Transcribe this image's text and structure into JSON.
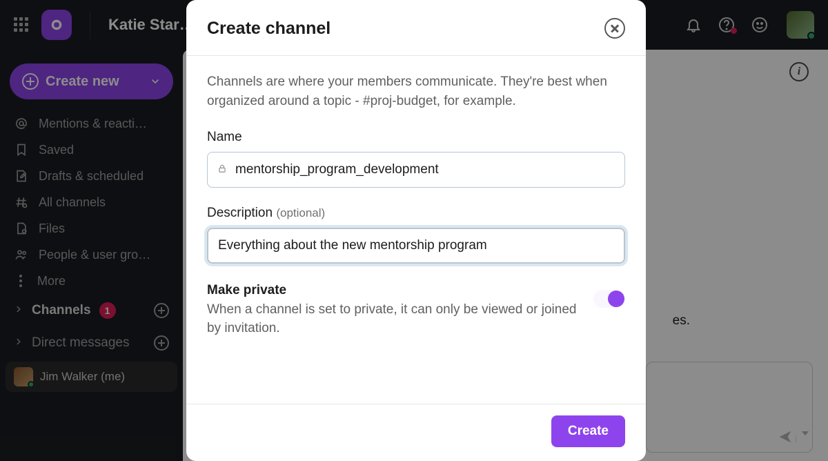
{
  "topbar": {
    "title": "Katie Star…"
  },
  "sidebar": {
    "create_label": "Create new",
    "items": [
      {
        "label": "Mentions & reacti…"
      },
      {
        "label": "Saved"
      },
      {
        "label": "Drafts & scheduled"
      },
      {
        "label": "All channels"
      },
      {
        "label": "Files"
      },
      {
        "label": "People & user gro…"
      },
      {
        "label": "More"
      }
    ],
    "channels_label": "Channels",
    "channels_badge": "1",
    "dms_label": "Direct messages",
    "dm_self": "Jim Walker (me)"
  },
  "main": {
    "fragment": "es."
  },
  "modal": {
    "title": "Create channel",
    "help": "Channels are where your members communicate. They're best when organized around a topic - #proj-budget, for example.",
    "name_label": "Name",
    "name_value": "mentorship_program_development",
    "desc_label": "Description",
    "desc_optional": "(optional)",
    "desc_value": "Everything about the new mentorship program",
    "private_title": "Make private",
    "private_help": "When a channel is set to private, it can only be viewed or joined by invitation.",
    "private_on": true,
    "submit_label": "Create"
  }
}
